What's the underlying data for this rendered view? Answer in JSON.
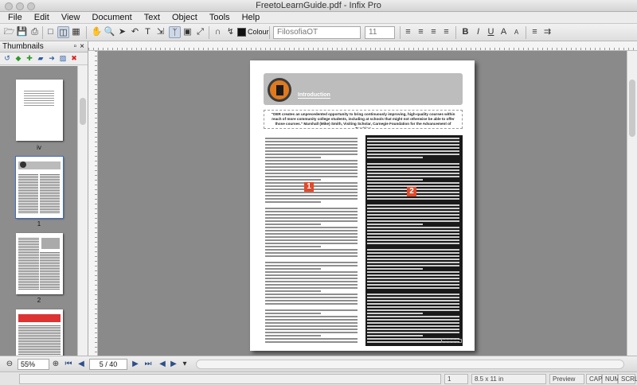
{
  "window": {
    "title": "FreetoLearnGuide.pdf - Infix Pro"
  },
  "menu": [
    "File",
    "Edit",
    "View",
    "Document",
    "Text",
    "Object",
    "Tools",
    "Help"
  ],
  "toolbar": {
    "colour_label": "Colour",
    "font_name": "FilosofiaOT",
    "font_size": "11",
    "bold": "B",
    "italic": "I",
    "underline": "U",
    "superscript": "A",
    "subscript": "A"
  },
  "thumbnails": {
    "title": "Thumbnails",
    "pages": [
      {
        "label": "iv"
      },
      {
        "label": "1"
      },
      {
        "label": "2"
      },
      {
        "label": ""
      }
    ]
  },
  "document": {
    "banner_title": "Introduction",
    "quote": "\"OER creates an unprecedented opportunity to bring continuously improving, high-quality courses within reach of more community college students, including at schools that might not otherwise be able to offer those courses.\" Marshall (Mike) Smith, Visiting Scholar, Carnegie Foundation for the Advancement of Teaching",
    "column_badges": [
      "1",
      "2"
    ]
  },
  "navigation": {
    "zoom": "55%",
    "page_indicator": "5 / 40"
  },
  "status": {
    "cell1": "",
    "cell2": "1",
    "page_size": "8.5 x 11 in",
    "mode": "Preview",
    "caps": "CAP",
    "num": "NUM",
    "scroll": "SCRL"
  },
  "colors": {
    "accent_orange": "#e07a1f",
    "badge_red": "#e04a2a",
    "canvas_gray": "#8a8a8a"
  }
}
